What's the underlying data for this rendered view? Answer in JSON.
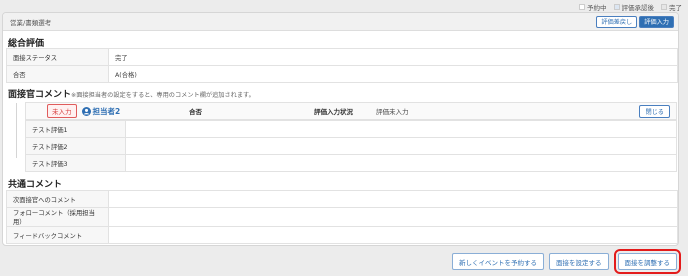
{
  "legend": [
    {
      "label": "予約中",
      "color": "#ffffff"
    },
    {
      "label": "評価承認後",
      "color": "#dce6f2"
    },
    {
      "label": "完了",
      "color": "#e6e6e6"
    }
  ],
  "panel": {
    "title": "営業/書類選考",
    "buttons": {
      "back": "評価差戻し",
      "input": "評価入力"
    }
  },
  "overall": {
    "title": "総合評価",
    "rows": [
      {
        "label": "面接ステータス",
        "value": "完了"
      },
      {
        "label": "合否",
        "value": "A(合格)"
      }
    ]
  },
  "interviewer": {
    "title": "面接官コメント",
    "note": "※面接担当者の設定をすると、専用のコメント欄が追加されます。",
    "badge": "未入力",
    "name": "担当者2",
    "result_label": "合否",
    "status_label": "評価入力状況",
    "status_value": "評価未入力",
    "close": "閉じる",
    "rows": [
      {
        "label": "テスト評価1",
        "value": ""
      },
      {
        "label": "テスト評価2",
        "value": ""
      },
      {
        "label": "テスト評価3",
        "value": ""
      }
    ]
  },
  "common": {
    "title": "共通コメント",
    "rows": [
      {
        "label": "次面接官へのコメント",
        "value": ""
      },
      {
        "label": "フォローコメント（採用担当用）",
        "value": ""
      },
      {
        "label": "フィードバックコメント",
        "value": ""
      }
    ]
  },
  "footer": {
    "new_event": "新しくイベントを予約する",
    "set_interview": "面接を設定する",
    "adjust_interview": "面接を調整する"
  },
  "colors": {
    "accent": "#2f6fb3",
    "highlight": "#e31b1b",
    "badge": "#d63a3a"
  }
}
